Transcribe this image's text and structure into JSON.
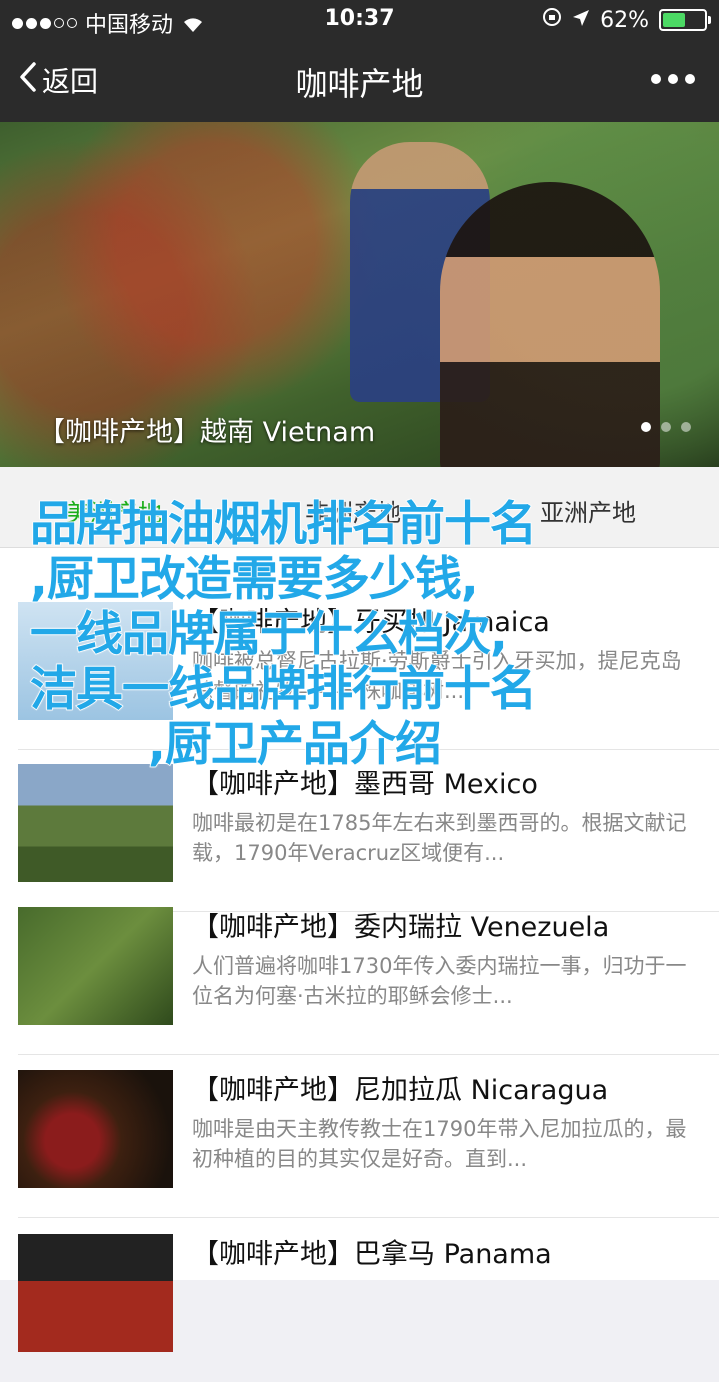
{
  "status_bar": {
    "carrier": "中国移动",
    "time": "10:37",
    "battery_percent": "62%",
    "battery_level": 0.62
  },
  "nav": {
    "back_label": "返回",
    "title": "咖啡产地"
  },
  "banner": {
    "caption": "【咖啡产地】越南 Vietnam",
    "active_index": 0,
    "slide_count": 3
  },
  "tabs": [
    {
      "label": "美洲产地",
      "active": true
    },
    {
      "label": "非洲产地",
      "active": false
    },
    {
      "label": "亚洲产地",
      "active": false
    }
  ],
  "items": [
    {
      "title": "【咖啡产地】牙买加 Jamaica",
      "desc": "咖啡被总督尼古拉斯·劳斯爵士引入牙买加，提尼克岛总督的礼物——一株咖啡树...",
      "thumb_icon": "jamaica-map-thumb"
    },
    {
      "title": "【咖啡产地】墨西哥 Mexico",
      "desc": "咖啡最初是在1785年左右来到墨西哥的。根据文献记载，1790年Veracruz区域便有...",
      "thumb_icon": "mexico-landscape-thumb"
    },
    {
      "title": "【咖啡产地】委内瑞拉 Venezuela",
      "desc": "人们普遍将咖啡1730年传入委内瑞拉一事，归功于一位名为何塞·古米拉的耶稣会修士...",
      "thumb_icon": "venezuela-farmer-thumb"
    },
    {
      "title": "【咖啡产地】尼加拉瓜 Nicaragua",
      "desc": "咖啡是由天主教传教士在1790年带入尼加拉瓜的，最初种植的目的其实仅是好奇。直到...",
      "thumb_icon": "nicaragua-cherries-thumb"
    },
    {
      "title": "【咖啡产地】巴拿马 Panama",
      "desc": "",
      "thumb_icon": "panama-cherries-thumb"
    }
  ],
  "overlay": {
    "lines": [
      "品牌抽油烟机排名前十名",
      ",厨卫改造需要多少钱,",
      "一线品牌属于什么档次,",
      "洁具一线品牌排行前十名",
      ",厨卫产品介绍"
    ],
    "color": "#22a8e8"
  },
  "colors": {
    "bar_bg": "#2b2b2b",
    "tab_active": "#1aad19",
    "battery": "#4cd964"
  }
}
